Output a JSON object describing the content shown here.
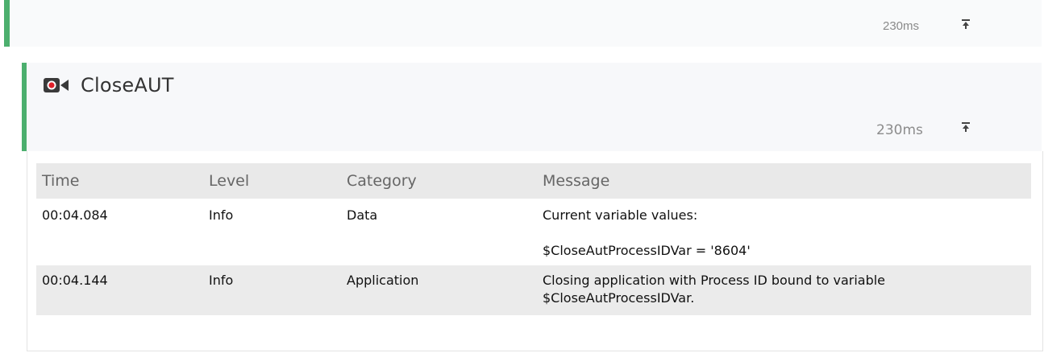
{
  "parent_step": {
    "duration": "230ms",
    "collapse_icon": "collapse-up-icon"
  },
  "step": {
    "title": "CloseAUT",
    "icon": "record-video-icon",
    "duration": "230ms",
    "collapse_icon": "collapse-up-icon",
    "accent_color": "#4caf6e"
  },
  "log": {
    "columns": [
      "Time",
      "Level",
      "Category",
      "Message"
    ],
    "rows": [
      {
        "time": "00:04.084",
        "level": "Info",
        "category": "Data",
        "message_line1": "Current variable values:",
        "message_line2": "$CloseAutProcessIDVar = '8604'"
      },
      {
        "time": "00:04.144",
        "level": "Info",
        "category": "Application",
        "message_line1": "Closing application with Process ID bound to variable",
        "message_line2": "$CloseAutProcessIDVar."
      }
    ]
  }
}
